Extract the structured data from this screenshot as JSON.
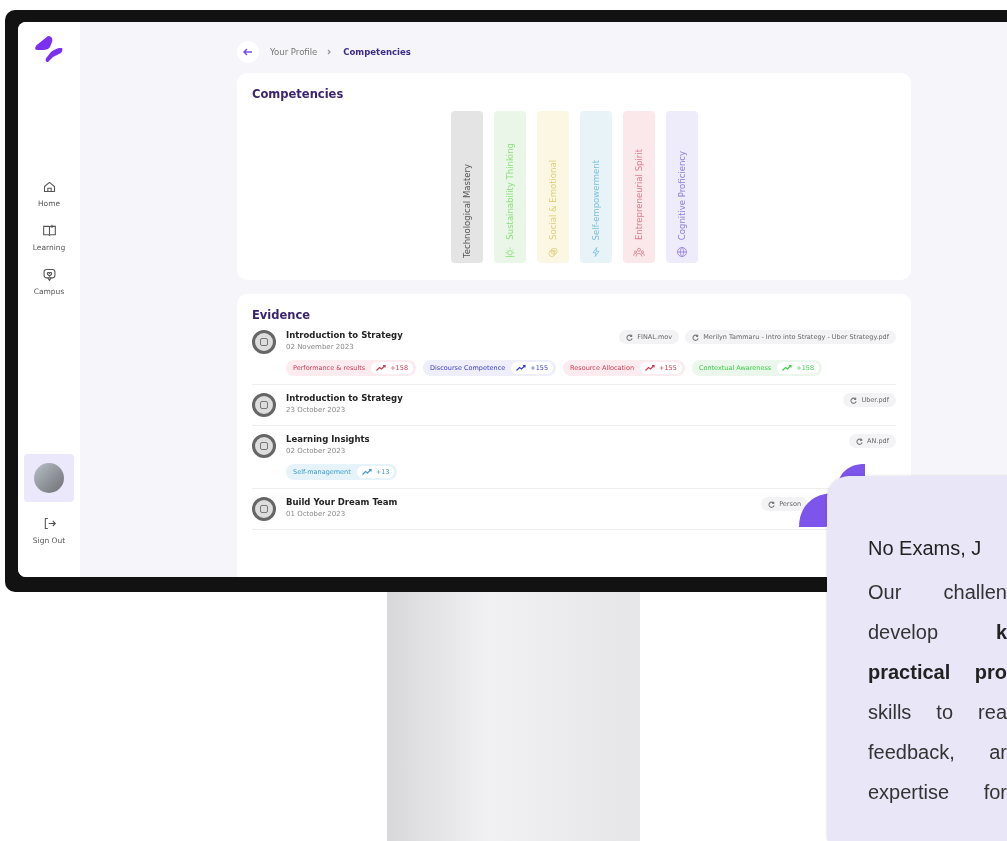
{
  "sidebar": {
    "nav": [
      {
        "label": "Home"
      },
      {
        "label": "Learning"
      },
      {
        "label": "Campus"
      }
    ],
    "profile": {
      "selected": true
    },
    "sign_out": {
      "label": "Sign Out"
    }
  },
  "breadcrumb": [
    "Your Profile",
    "Competencies"
  ],
  "competencies": {
    "title": "Competencies",
    "items": [
      {
        "name": "Technological Mastery",
        "color": "#e4e4e4"
      },
      {
        "name": "Sustainability Thinking",
        "color": "#eaf6e8"
      },
      {
        "name": "Social & Emotional",
        "color": "#fbf7e2"
      },
      {
        "name": "Self-empowerment",
        "color": "#e8f3f8"
      },
      {
        "name": "Entrepreneurial Spirit",
        "color": "#fbe8eb"
      },
      {
        "name": "Cognitive Proficiency",
        "color": "#eeebfb"
      }
    ]
  },
  "evidence": {
    "title": "Evidence",
    "rows": [
      {
        "title": "Introduction to Strategy",
        "date": "02 November 2023",
        "files": [
          "FINAL.mov",
          "Merilyn Tammaru - Intro into Strategy - Uber Strategy.pdf"
        ],
        "tags": [
          {
            "label": "Performance & results",
            "score": "+158",
            "color": "#fdecef"
          },
          {
            "label": "Discourse Competence",
            "score": "+155",
            "color": "#eeeefc"
          },
          {
            "label": "Resource Allocation",
            "score": "+155",
            "color": "#fdecef"
          },
          {
            "label": "Contextual Awareness",
            "score": "+158",
            "color": "#ebf7ec"
          }
        ]
      },
      {
        "title": "Introduction to Strategy",
        "date": "23 October 2023",
        "files": [
          "Uber.pdf"
        ],
        "tags": []
      },
      {
        "title": "Learning Insights",
        "date": "02 October 2023",
        "files": [
          "AN.pdf"
        ],
        "tags": [
          {
            "label": "Self-management",
            "score": "+13",
            "color": "#e6f3fa"
          }
        ]
      },
      {
        "title": "Build Your Dream Team",
        "date": "01 October 2023",
        "files": [
          "Person"
        ],
        "tags": []
      }
    ]
  },
  "promo": {
    "title": "No Exams, J",
    "text": "Our challen\ndevelop **k**\n**practical pro**\nskills to rea\nfeedback, ar\nexpertise for"
  }
}
